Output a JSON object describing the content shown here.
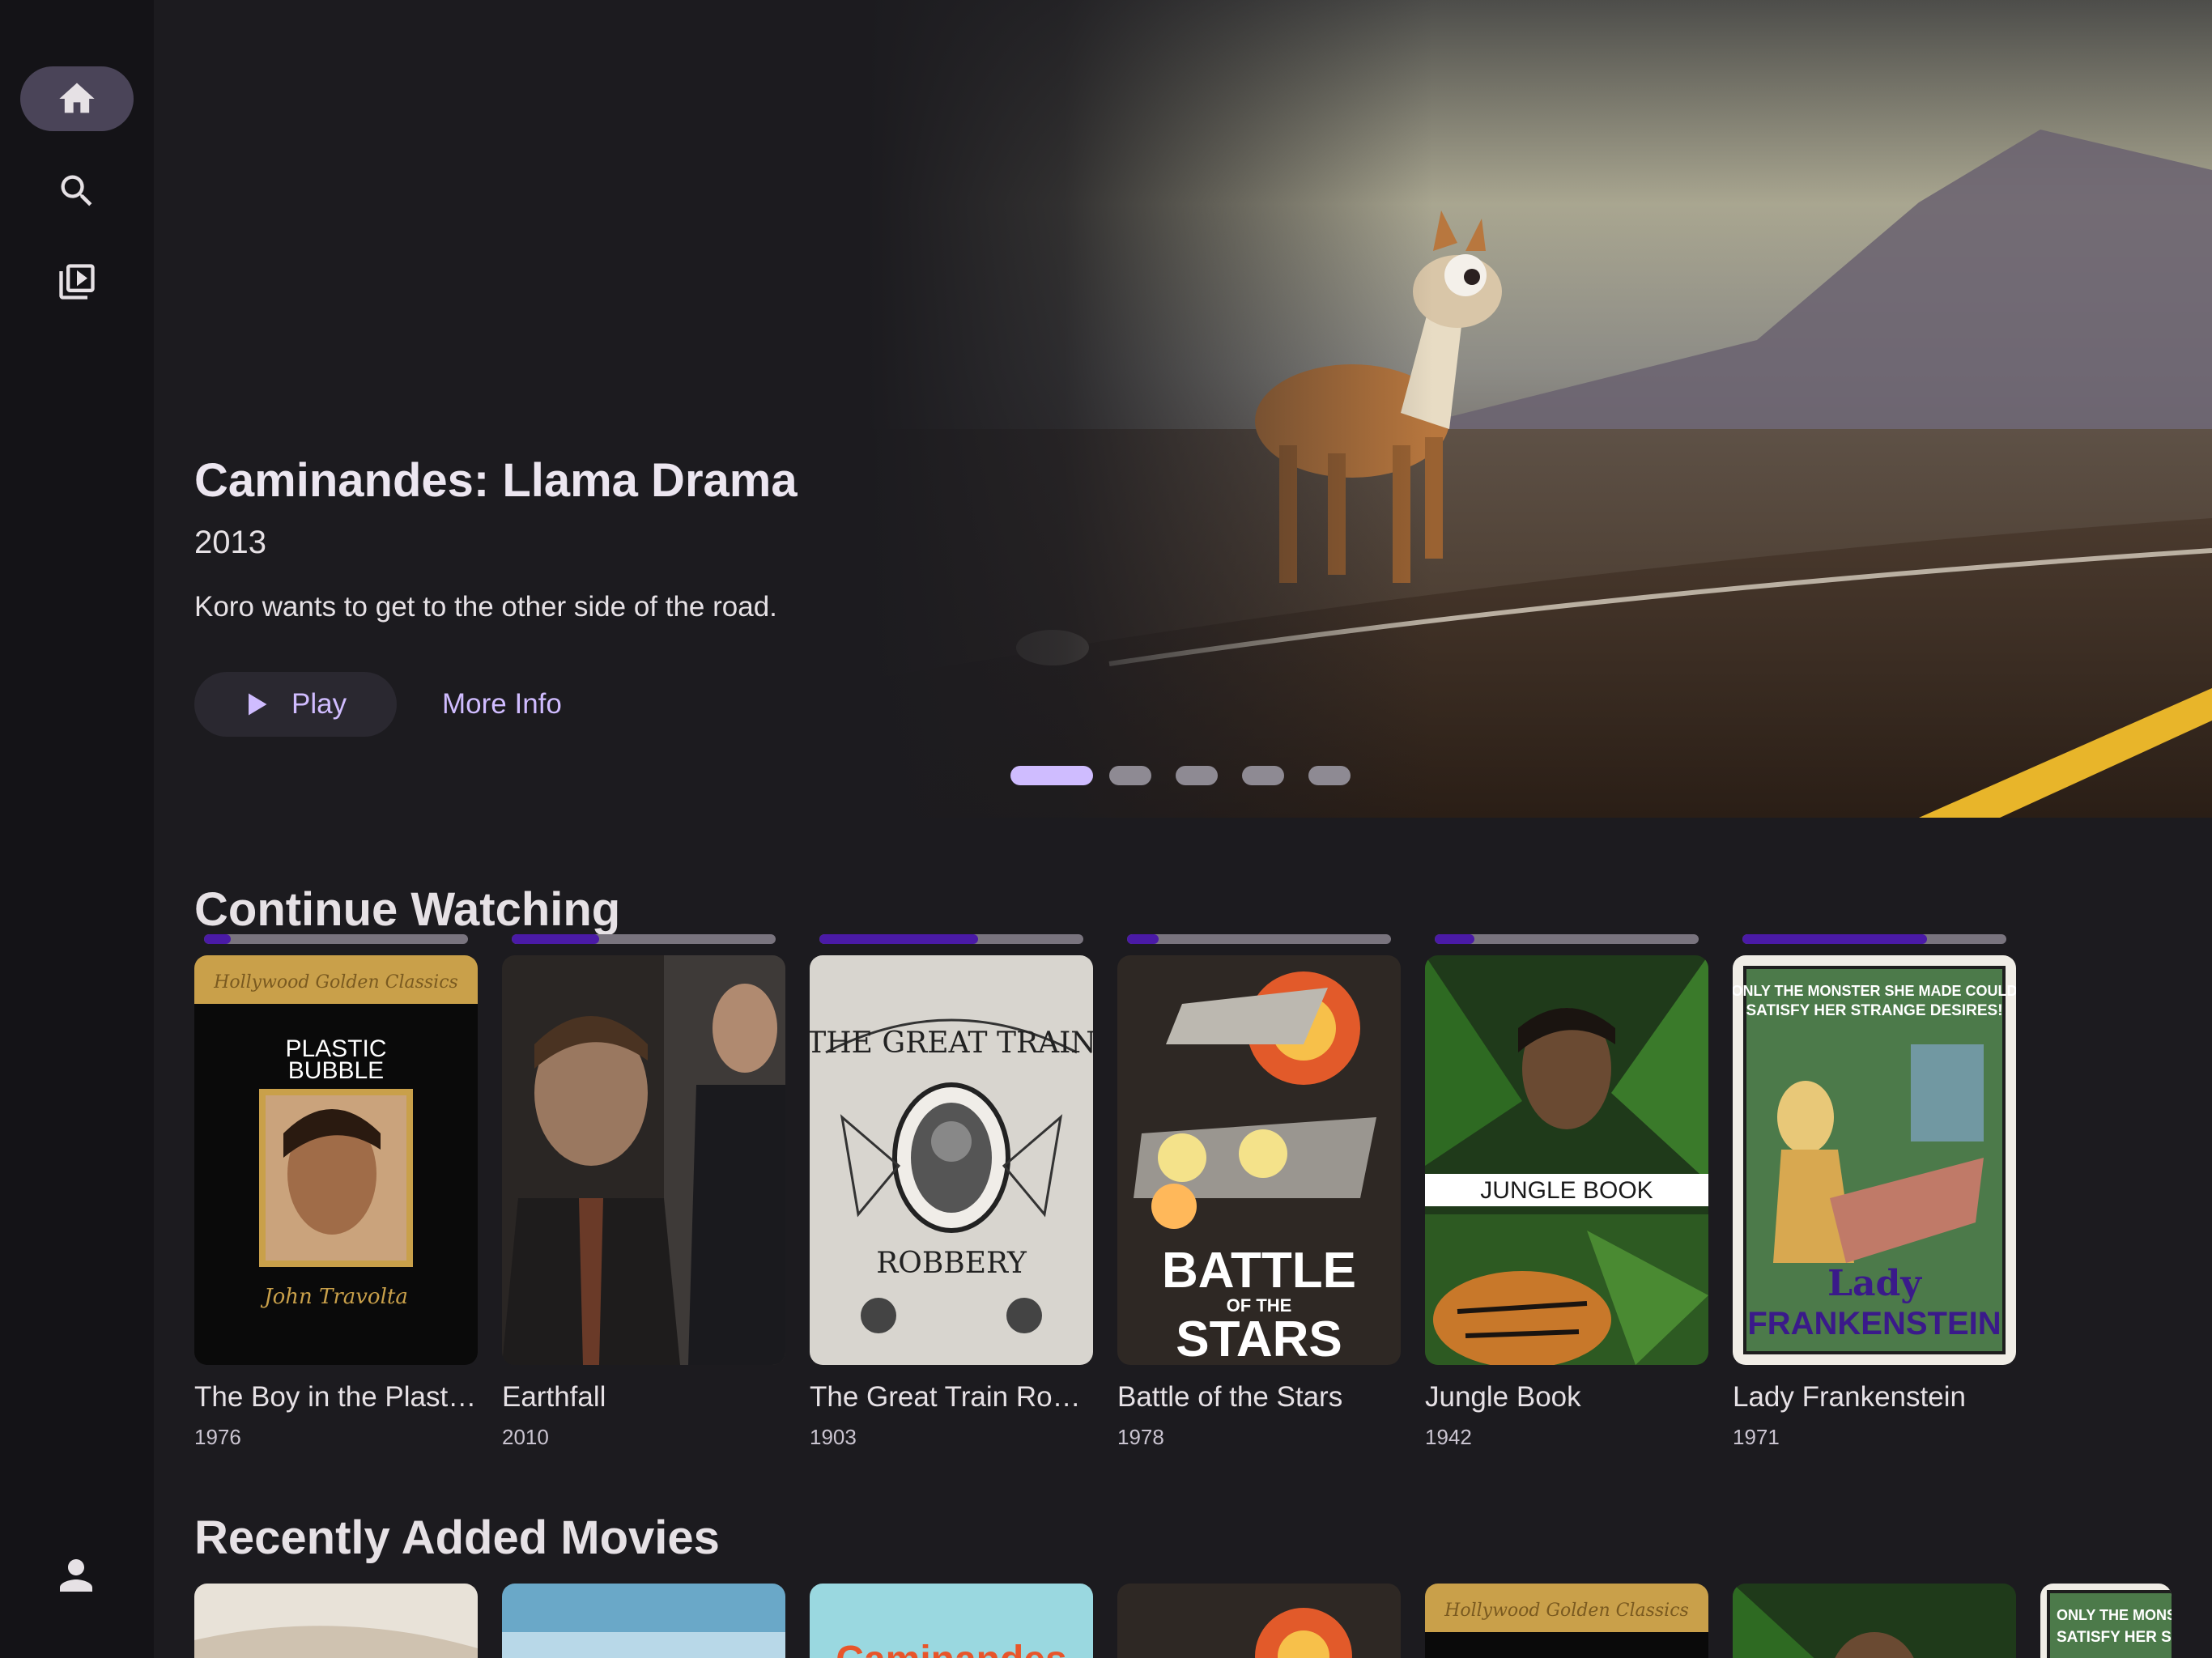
{
  "hero": {
    "title": "Caminandes: Llama Drama",
    "year": "2013",
    "description": "Koro wants to get to the other side of the road.",
    "play_label": "Play",
    "more_info_label": "More Info",
    "carousel_pages": 5,
    "carousel_active": 1
  },
  "continue_watching": {
    "title": "Continue Watching",
    "items": [
      {
        "title": "The Boy in the Plastic Bubble",
        "year": "1976",
        "progress": 0.1,
        "poster_lines": [
          "Hollywood Golden Classics",
          "PLASTIC",
          "BUBBLE",
          "John Travolta"
        ]
      },
      {
        "title": "Earthfall",
        "year": "2010",
        "progress": 0.33
      },
      {
        "title": "The Great Train Robbery",
        "year": "1903",
        "progress": 0.6,
        "poster_lines": [
          "THE GREAT TRAIN",
          "ROBBERY"
        ]
      },
      {
        "title": "Battle of the Stars",
        "year": "1978",
        "progress": 0.12,
        "poster_lines": [
          "BATTLE",
          "OF THE",
          "STARS"
        ]
      },
      {
        "title": "Jungle Book",
        "year": "1942",
        "progress": 0.15,
        "poster_lines": [
          "JUNGLE BOOK"
        ]
      },
      {
        "title": "Lady Frankenstein",
        "year": "1971",
        "progress": 0.7,
        "poster_lines": [
          "ONLY THE MONSTER SHE MADE COULD",
          "SATISFY HER STRANGE DESIRES!",
          "Lady",
          "FRANKENSTEIN"
        ]
      }
    ]
  },
  "recently_added": {
    "title": "Recently Added Movies",
    "poster_lines": [
      "Caminandes",
      "Hollywood Golden Classics",
      "ONLY THE MONSTE",
      "SATISFY HER S"
    ]
  },
  "colors": {
    "accent": "#d0bcff",
    "background": "#1c1b1f",
    "sidebar": "#141317",
    "progress_fill": "#4a1aa6"
  },
  "icons": {
    "nav": [
      "home-icon",
      "search-icon",
      "library-icon"
    ],
    "profile": "person-icon"
  }
}
